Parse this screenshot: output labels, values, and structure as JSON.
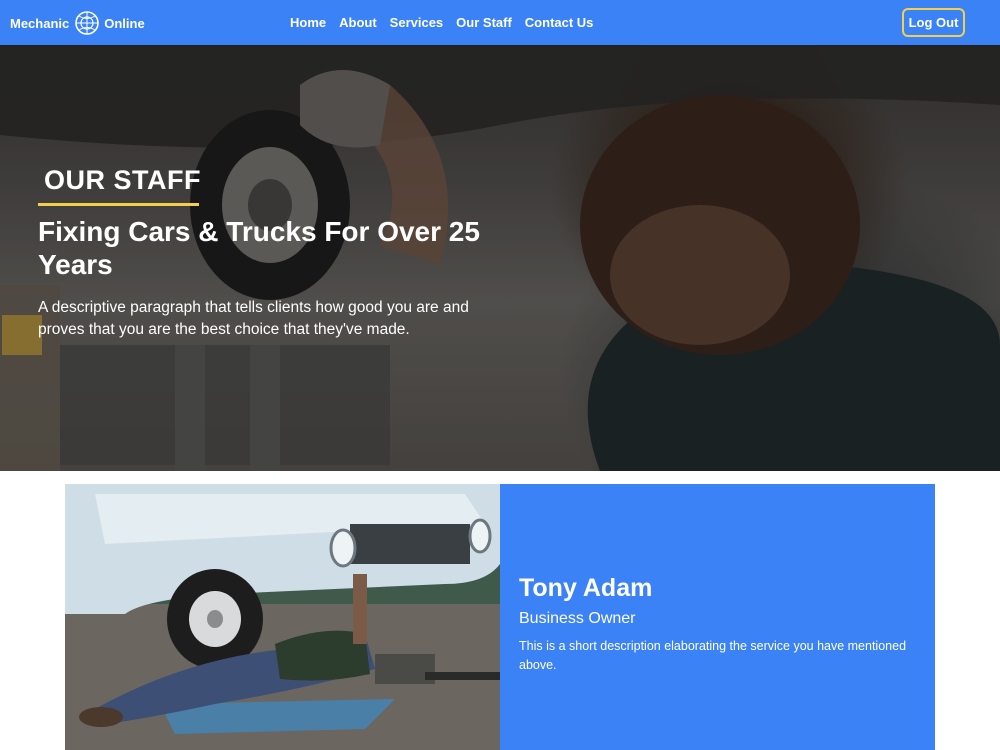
{
  "navbar": {
    "brand_left": "Mechanic",
    "brand_right": "Online",
    "links": [
      "Home",
      "About",
      "Services",
      "Our Staff",
      "Contact Us"
    ],
    "logout_label": "Log Out",
    "background": "#3b82f6",
    "accent": "#f2d04a"
  },
  "hero": {
    "eyebrow": "OUR STAFF",
    "title": "Fixing Cars & Trucks For Over 25 Years",
    "text": "A descriptive paragraph that tells clients how good you are and proves that you are the best choice that they've made."
  },
  "staff": {
    "name": "Tony Adam",
    "role": "Business Owner",
    "description": "This is a short description elaborating the service you have mentioned above.",
    "card_color": "#3b82f6"
  }
}
